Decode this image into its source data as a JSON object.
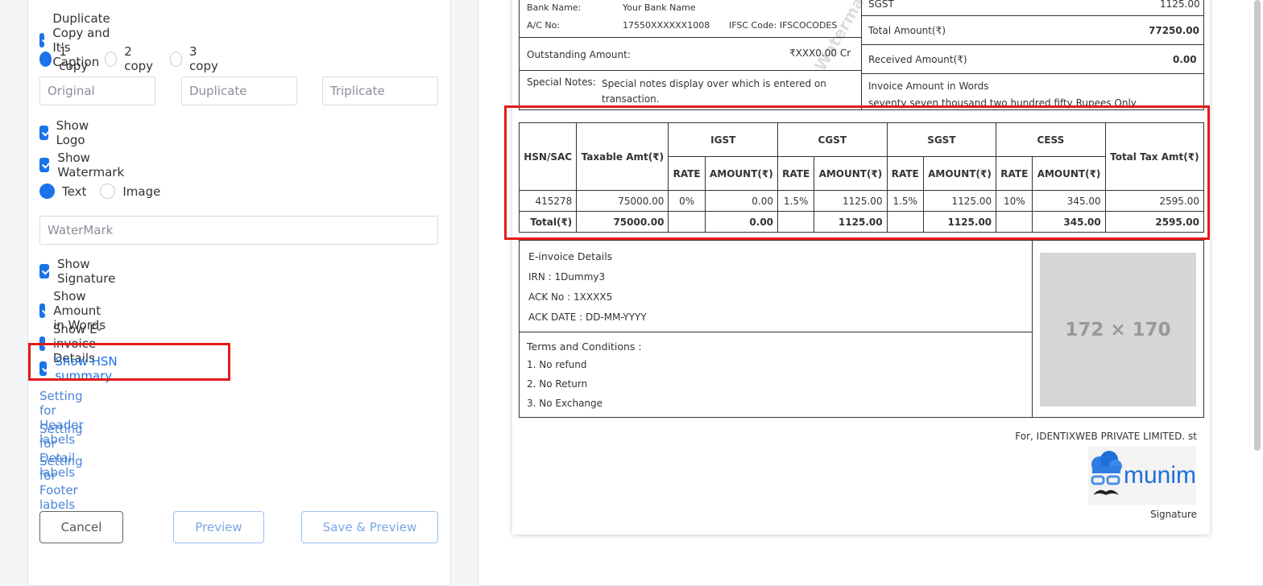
{
  "settings": {
    "duplicate_copy": "Duplicate Copy and It's Caption",
    "copies": [
      "1 copy",
      "2 copy",
      "3 copy"
    ],
    "caption_placeholders": [
      "Original",
      "Duplicate",
      "Triplicate"
    ],
    "show_logo": "Show Logo",
    "show_watermark": "Show Watermark",
    "watermark_types": [
      "Text",
      "Image"
    ],
    "watermark_placeholder": "WaterMark",
    "show_signature": "Show Signature",
    "show_amount_words": "Show Amount in Words",
    "show_einvoice": "Show E-invoice Details",
    "show_hsn": "Show HSN summary",
    "links": [
      "Setting for Header labels",
      "Setting for Detail labels",
      "Setting for Footer labels"
    ],
    "buttons": {
      "cancel": "Cancel",
      "preview": "Preview",
      "save_preview": "Save & Preview"
    }
  },
  "invoice": {
    "bank_name_label": "Bank Name:",
    "bank_name": "Your Bank Name",
    "ac_label": "A/C No:",
    "ac_no": "17550XXXXXX1008",
    "ifsc": "IFSC Code: IFSCOCODES",
    "outstanding_label": "Outstanding Amount:",
    "outstanding": "₹XXX0.00 Cr",
    "notes_label": "Special Notes:",
    "notes": "Special notes display over which is entered on transaction.",
    "sgst_label": "SGST",
    "sgst": "1125.00",
    "total_label": "Total Amount(₹)",
    "total": "77250.00",
    "received_label": "Received Amount(₹)",
    "received": "0.00",
    "words_label": "Invoice Amount in Words",
    "words": "seventy seven thousand two hundred fifty Rupees Only",
    "watermark": "Watermark",
    "hsn": {
      "headers": {
        "hsn": "HSN/SAC",
        "taxable": "Taxable Amt(₹)",
        "igst": "IGST",
        "cgst": "CGST",
        "sgst": "SGST",
        "cess": "CESS",
        "total_tax": "Total Tax Amt(₹)",
        "rate": "RATE",
        "amount": "AMOUNT(₹)"
      },
      "row": [
        "415278",
        "75000.00",
        "0%",
        "0.00",
        "1.5%",
        "1125.00",
        "1.5%",
        "1125.00",
        "10%",
        "345.00",
        "2595.00"
      ],
      "total": [
        "Total(₹)",
        "75000.00",
        "",
        "0.00",
        "",
        "1125.00",
        "",
        "1125.00",
        "",
        "345.00",
        "2595.00"
      ]
    },
    "einvoice": {
      "title": "E-invoice Details",
      "irn": "IRN : 1Dummy3",
      "ack": "ACK No : 1XXXX5",
      "ack_date": "ACK DATE : DD-MM-YYYY"
    },
    "terms": {
      "title": "Terms and Conditions :",
      "items": [
        "1. No refund",
        "2. No Return",
        "3. No Exchange"
      ]
    },
    "qr_placeholder": "172 × 170",
    "for_company": "For, IDENTIXWEB PRIVATE LIMITED. st",
    "logo_text": "munim",
    "signature": "Signature"
  }
}
